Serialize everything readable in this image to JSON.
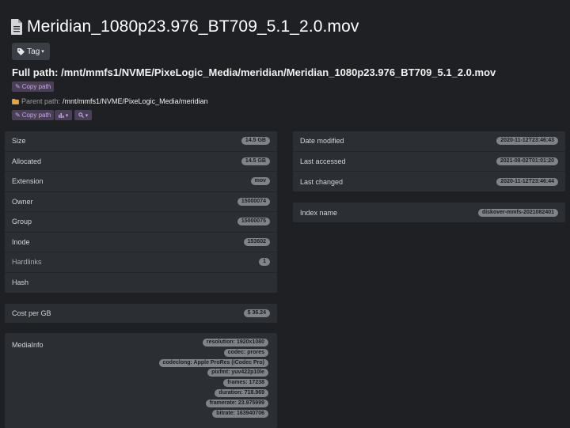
{
  "title": "Meridian_1080p23.976_BT709_5.1_2.0.mov",
  "tag_button": {
    "label": "Tag"
  },
  "full_path": {
    "label": "Full path:",
    "value": "/mnt/mmfs1/NVME/PixeLogic_Media/meridian/Meridian_1080p23.976_BT709_5.1_2.0.mov"
  },
  "copy_path_label": "Copy path",
  "parent_path": {
    "label": "Parent path:",
    "value": "/mnt/mmfs1/NVME/PixeLogic_Media/meridian"
  },
  "icons": {
    "file": "file-icon",
    "tag": "tag-icon",
    "folder": "folder-icon",
    "copy": "copy-icon",
    "chart": "chart-icon",
    "search": "search-icon"
  },
  "left_panel": [
    {
      "key": "Size",
      "value": "14.5 GB"
    },
    {
      "key": "Allocated",
      "value": "14.5 GB"
    },
    {
      "key": "Extension",
      "value": "mov"
    },
    {
      "key": "Owner",
      "value": "15000074"
    },
    {
      "key": "Group",
      "value": "15000075"
    },
    {
      "key": "Inode",
      "value": "153602"
    },
    {
      "key": "Hardlinks",
      "value": "1"
    },
    {
      "key": "Hash",
      "value": ""
    }
  ],
  "cost": {
    "key": "Cost per GB",
    "value": "$ 36.24"
  },
  "mediainfo": {
    "key": "MediaInfo",
    "items": [
      "resolution: 1920x1080",
      "codec: prores",
      "codeclong: Apple ProRes (iCodec Pro)",
      "pixfmt: yuv422p10le",
      "frames: 17238",
      "duration: 718.969",
      "framerate: 23.975999",
      "bitrate: 163940706"
    ]
  },
  "right_panel": [
    {
      "key": "Date modified",
      "value": "2020-11-12T23:46:43"
    },
    {
      "key": "Last accessed",
      "value": "2021-08-02T01:01:20"
    },
    {
      "key": "Last changed",
      "value": "2020-11-12T23:46:44"
    }
  ],
  "index": {
    "key": "Index name",
    "value": "diskover-mmfs-2021082401"
  },
  "colors": {
    "background": "#1f2024",
    "panel": "#2b2e33",
    "badge": "#808489",
    "copy_button": "#4a3f57",
    "copy_text": "#c7a6e8",
    "folder": "#e8a33c"
  }
}
